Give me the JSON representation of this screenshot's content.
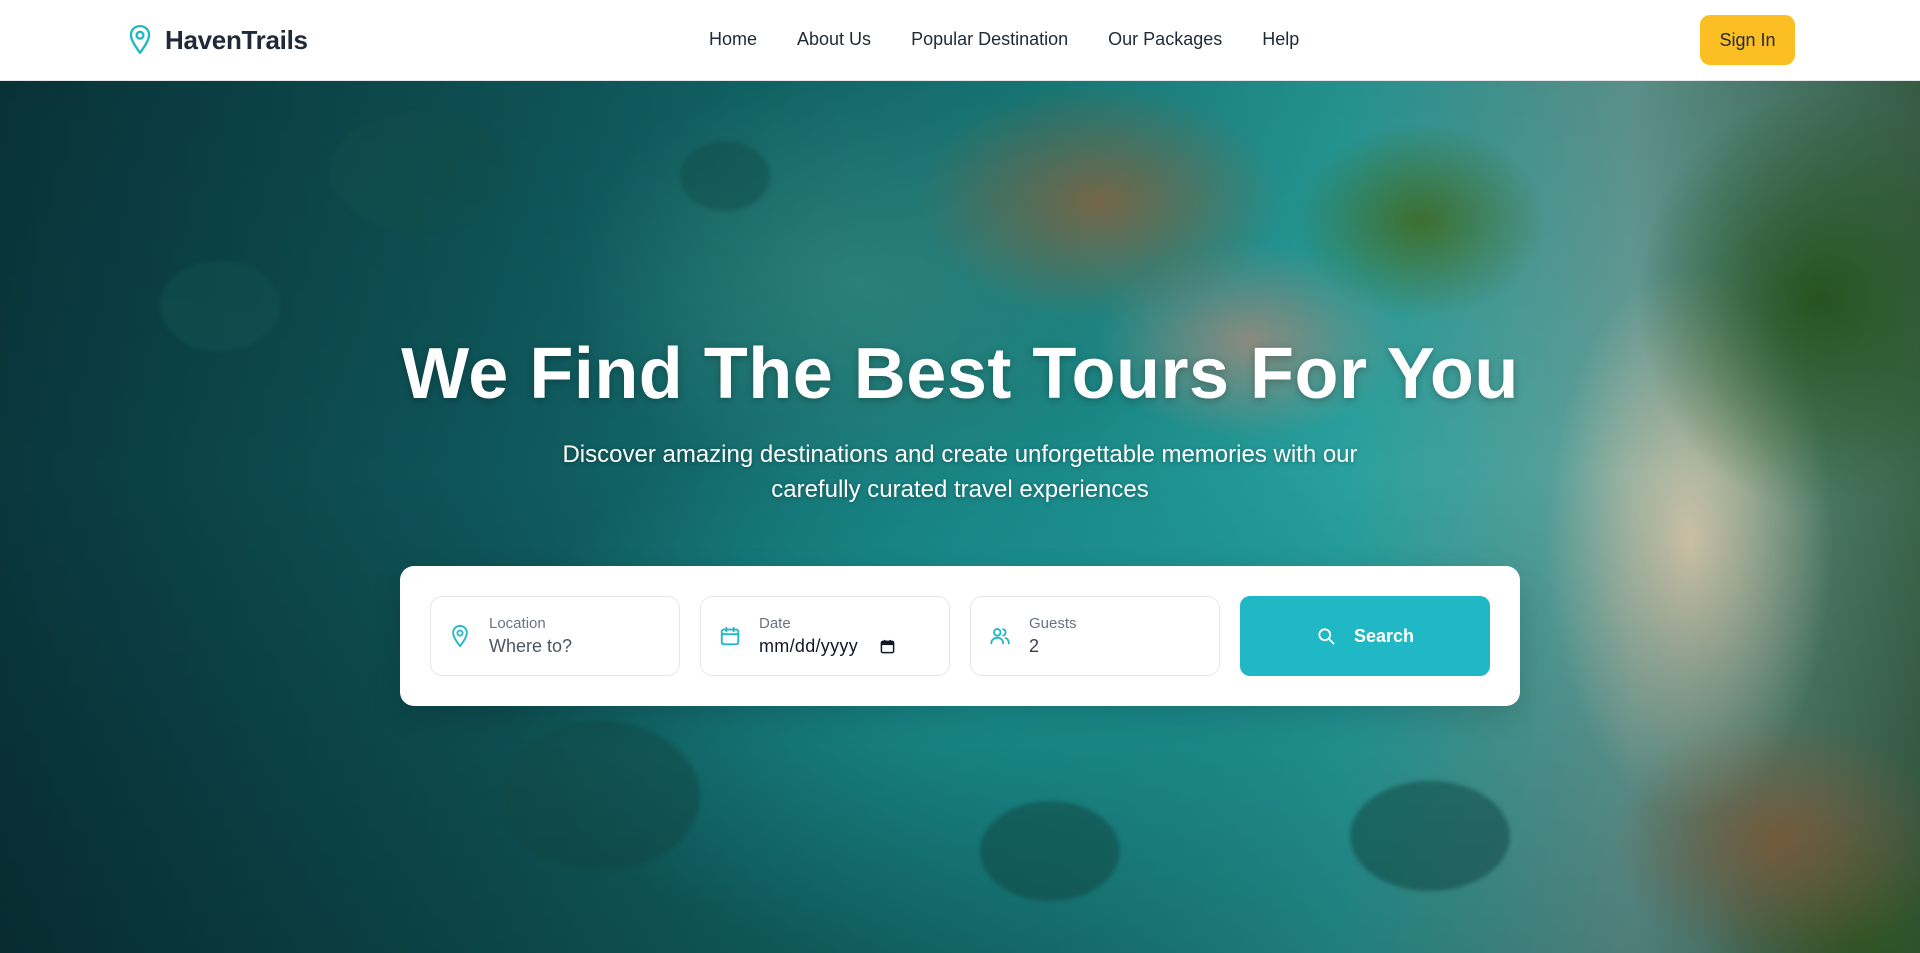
{
  "brand": {
    "name": "HavenTrails",
    "icon": "map-pin-icon"
  },
  "nav": {
    "links": [
      "Home",
      "About Us",
      "Popular Destination",
      "Our Packages",
      "Help"
    ],
    "signin_label": "Sign In"
  },
  "hero": {
    "title": "We Find The Best Tours For You",
    "subtitle": "Discover amazing destinations and create unforgettable memories with our carefully curated travel experiences"
  },
  "search": {
    "location": {
      "label": "Location",
      "placeholder": "Where to?",
      "icon": "map-pin-icon"
    },
    "date": {
      "label": "Date",
      "value": "mm/dd/yyyy",
      "icon": "calendar-icon"
    },
    "guests": {
      "label": "Guests",
      "value": "2",
      "icon": "users-icon"
    },
    "button_label": "Search",
    "button_icon": "search-icon"
  },
  "colors": {
    "accent": "#1fb8c4",
    "signin_bg": "#fbbf24",
    "text_dark": "#1f2937"
  }
}
